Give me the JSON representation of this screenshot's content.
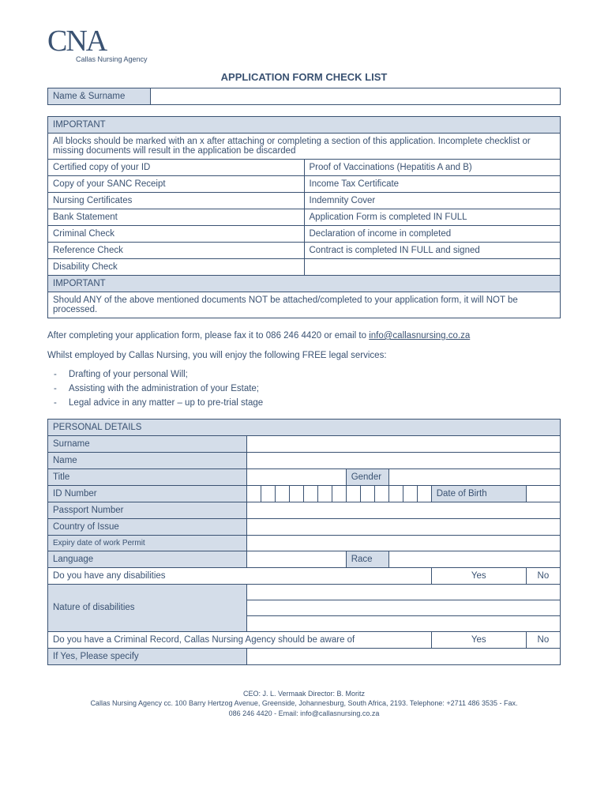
{
  "logo": {
    "main": "CNA",
    "sub": "Callas Nursing Agency"
  },
  "title": "APPLICATION FORM CHECK LIST",
  "name_row": {
    "label": "Name & Surname"
  },
  "important": {
    "heading": "IMPORTANT",
    "intro": "All blocks should be marked with an x after attaching or completing a section of this application. Incomplete checklist or missing documents will result in the application be discarded",
    "rows": [
      {
        "l": "Certified copy of your ID",
        "r": "Proof of Vaccinations (Hepatitis A and B)"
      },
      {
        "l": "Copy of your SANC Receipt",
        "r": "Income Tax Certificate"
      },
      {
        "l": "Nursing Certificates",
        "r": "Indemnity Cover"
      },
      {
        "l": "Bank Statement",
        "r": "Application Form is completed IN FULL"
      },
      {
        "l": "Criminal Check",
        "r": "Declaration of income in completed"
      },
      {
        "l": "Reference Check",
        "r": "Contract is completed IN FULL and signed"
      },
      {
        "l": "Disability Check",
        "r": ""
      }
    ],
    "footer_heading": "IMPORTANT",
    "footer_text": "Should ANY of the above mentioned documents NOT be attached/completed to your application form, it will NOT be processed."
  },
  "after_text": "After completing your application form, please fax it to 086 246 4420 or email to ",
  "email": "info@callasnursing.co.za",
  "whilst_text": "Whilst employed by Callas Nursing, you will enjoy the following FREE legal services:",
  "services": [
    "Drafting of your personal Will;",
    "Assisting with the administration of your Estate;",
    "Legal advice in any matter – up to pre-trial stage"
  ],
  "personal": {
    "heading": "PERSONAL DETAILS",
    "surname": "Surname",
    "name": "Name",
    "title": "Title",
    "gender": "Gender",
    "id": "ID Number",
    "dob": "Date of Birth",
    "passport": "Passport Number",
    "country": "Country of Issue",
    "expiry": "Expiry date of work Permit",
    "language": "Language",
    "race": "Race",
    "disabilities_q": "Do you have any disabilities",
    "yes": "Yes",
    "no": "No",
    "nature": "Nature of disabilities",
    "criminal_q": "Do you have a Criminal Record, Callas Nursing Agency should be aware of",
    "specify": "If Yes, Please specify"
  },
  "footer": {
    "line1": "CEO: J. L. Vermaak Director: B. Moritz",
    "line2": "Callas Nursing Agency cc. 100 Barry Hertzog Avenue, Greenside, Johannesburg, South Africa, 2193. Telephone: +2711 486 3535 - Fax.",
    "line3": "086 246 4420 - Email: info@callasnursing.co.za"
  }
}
